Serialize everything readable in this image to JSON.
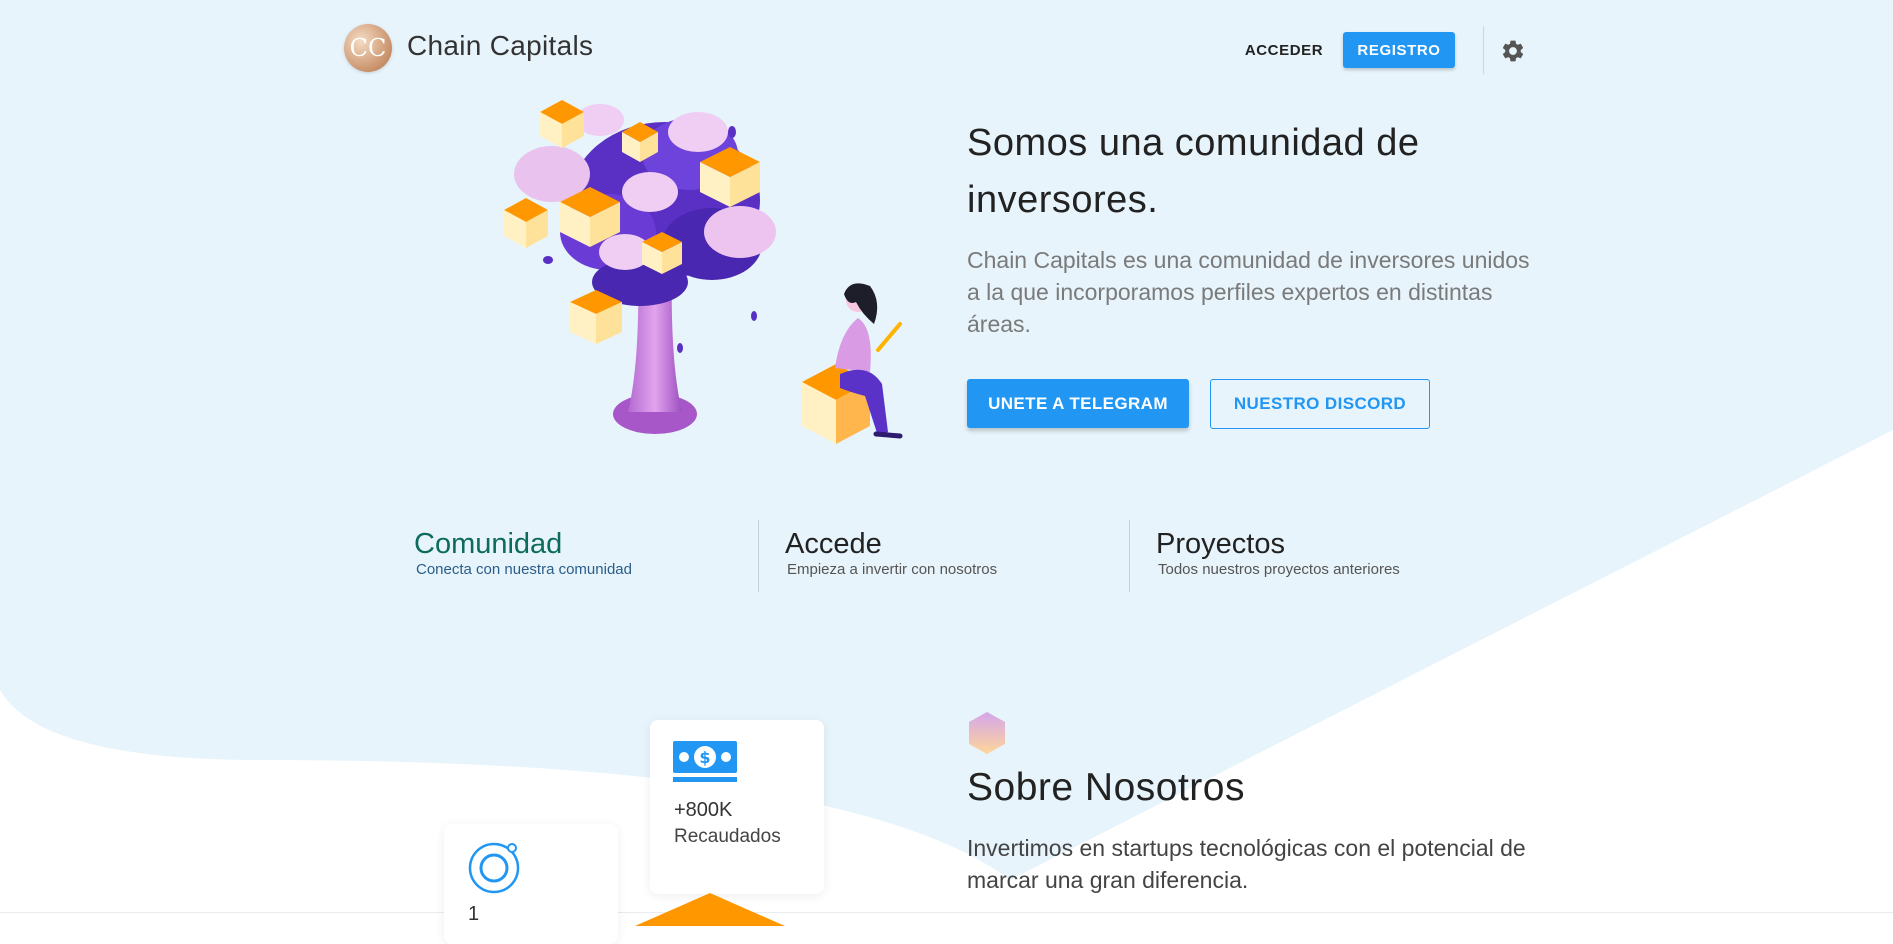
{
  "header": {
    "brand_name": "Chain Capitals",
    "logo_text": "CC",
    "login_label": "ACCEDER",
    "register_label": "REGISTRO",
    "settings_icon": "gear-icon"
  },
  "hero": {
    "title": "Somos una comunidad de inversores.",
    "description": "Chain Capitals es una comunidad de inversores unidos a la que incorporamos perfiles expertos en distintas áreas.",
    "telegram_button": "UNETE A TELEGRAM",
    "discord_button": "NUESTRO DISCORD"
  },
  "features": [
    {
      "title": "Comunidad",
      "subtitle": "Conecta con nuestra comunidad",
      "active": true
    },
    {
      "title": "Accede",
      "subtitle": "Empieza a invertir con nosotros",
      "active": false
    },
    {
      "title": "Proyectos",
      "subtitle": "Todos nuestros proyectos anteriores",
      "active": false
    }
  ],
  "stats": [
    {
      "icon": "money-icon",
      "value": "+800K",
      "label": "Recaudados"
    },
    {
      "icon": "ring-icon",
      "value": "1",
      "label": ""
    }
  ],
  "about": {
    "title": "Sobre Nosotros",
    "description": "Invertimos en startups tecnológicas con el potencial de marcar una gran diferencia."
  },
  "colors": {
    "primary": "#2196f3",
    "hero_background": "#e7f4fb",
    "accent_orange": "#ff9800",
    "active_feature": "#0d6b5e"
  }
}
